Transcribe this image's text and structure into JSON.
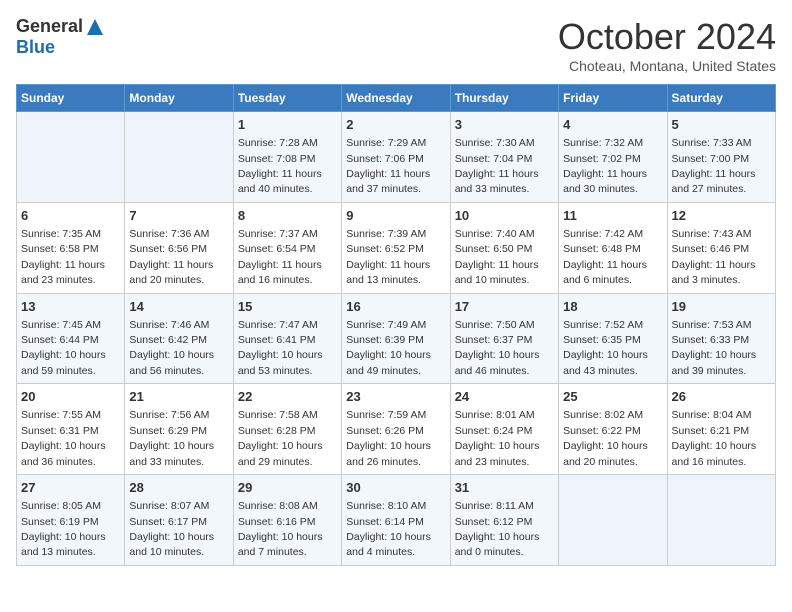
{
  "header": {
    "logo_general": "General",
    "logo_blue": "Blue",
    "title": "October 2024",
    "location": "Choteau, Montana, United States"
  },
  "days_of_week": [
    "Sunday",
    "Monday",
    "Tuesday",
    "Wednesday",
    "Thursday",
    "Friday",
    "Saturday"
  ],
  "weeks": [
    [
      {
        "day": "",
        "info": ""
      },
      {
        "day": "",
        "info": ""
      },
      {
        "day": "1",
        "info": "Sunrise: 7:28 AM\nSunset: 7:08 PM\nDaylight: 11 hours and 40 minutes."
      },
      {
        "day": "2",
        "info": "Sunrise: 7:29 AM\nSunset: 7:06 PM\nDaylight: 11 hours and 37 minutes."
      },
      {
        "day": "3",
        "info": "Sunrise: 7:30 AM\nSunset: 7:04 PM\nDaylight: 11 hours and 33 minutes."
      },
      {
        "day": "4",
        "info": "Sunrise: 7:32 AM\nSunset: 7:02 PM\nDaylight: 11 hours and 30 minutes."
      },
      {
        "day": "5",
        "info": "Sunrise: 7:33 AM\nSunset: 7:00 PM\nDaylight: 11 hours and 27 minutes."
      }
    ],
    [
      {
        "day": "6",
        "info": "Sunrise: 7:35 AM\nSunset: 6:58 PM\nDaylight: 11 hours and 23 minutes."
      },
      {
        "day": "7",
        "info": "Sunrise: 7:36 AM\nSunset: 6:56 PM\nDaylight: 11 hours and 20 minutes."
      },
      {
        "day": "8",
        "info": "Sunrise: 7:37 AM\nSunset: 6:54 PM\nDaylight: 11 hours and 16 minutes."
      },
      {
        "day": "9",
        "info": "Sunrise: 7:39 AM\nSunset: 6:52 PM\nDaylight: 11 hours and 13 minutes."
      },
      {
        "day": "10",
        "info": "Sunrise: 7:40 AM\nSunset: 6:50 PM\nDaylight: 11 hours and 10 minutes."
      },
      {
        "day": "11",
        "info": "Sunrise: 7:42 AM\nSunset: 6:48 PM\nDaylight: 11 hours and 6 minutes."
      },
      {
        "day": "12",
        "info": "Sunrise: 7:43 AM\nSunset: 6:46 PM\nDaylight: 11 hours and 3 minutes."
      }
    ],
    [
      {
        "day": "13",
        "info": "Sunrise: 7:45 AM\nSunset: 6:44 PM\nDaylight: 10 hours and 59 minutes."
      },
      {
        "day": "14",
        "info": "Sunrise: 7:46 AM\nSunset: 6:42 PM\nDaylight: 10 hours and 56 minutes."
      },
      {
        "day": "15",
        "info": "Sunrise: 7:47 AM\nSunset: 6:41 PM\nDaylight: 10 hours and 53 minutes."
      },
      {
        "day": "16",
        "info": "Sunrise: 7:49 AM\nSunset: 6:39 PM\nDaylight: 10 hours and 49 minutes."
      },
      {
        "day": "17",
        "info": "Sunrise: 7:50 AM\nSunset: 6:37 PM\nDaylight: 10 hours and 46 minutes."
      },
      {
        "day": "18",
        "info": "Sunrise: 7:52 AM\nSunset: 6:35 PM\nDaylight: 10 hours and 43 minutes."
      },
      {
        "day": "19",
        "info": "Sunrise: 7:53 AM\nSunset: 6:33 PM\nDaylight: 10 hours and 39 minutes."
      }
    ],
    [
      {
        "day": "20",
        "info": "Sunrise: 7:55 AM\nSunset: 6:31 PM\nDaylight: 10 hours and 36 minutes."
      },
      {
        "day": "21",
        "info": "Sunrise: 7:56 AM\nSunset: 6:29 PM\nDaylight: 10 hours and 33 minutes."
      },
      {
        "day": "22",
        "info": "Sunrise: 7:58 AM\nSunset: 6:28 PM\nDaylight: 10 hours and 29 minutes."
      },
      {
        "day": "23",
        "info": "Sunrise: 7:59 AM\nSunset: 6:26 PM\nDaylight: 10 hours and 26 minutes."
      },
      {
        "day": "24",
        "info": "Sunrise: 8:01 AM\nSunset: 6:24 PM\nDaylight: 10 hours and 23 minutes."
      },
      {
        "day": "25",
        "info": "Sunrise: 8:02 AM\nSunset: 6:22 PM\nDaylight: 10 hours and 20 minutes."
      },
      {
        "day": "26",
        "info": "Sunrise: 8:04 AM\nSunset: 6:21 PM\nDaylight: 10 hours and 16 minutes."
      }
    ],
    [
      {
        "day": "27",
        "info": "Sunrise: 8:05 AM\nSunset: 6:19 PM\nDaylight: 10 hours and 13 minutes."
      },
      {
        "day": "28",
        "info": "Sunrise: 8:07 AM\nSunset: 6:17 PM\nDaylight: 10 hours and 10 minutes."
      },
      {
        "day": "29",
        "info": "Sunrise: 8:08 AM\nSunset: 6:16 PM\nDaylight: 10 hours and 7 minutes."
      },
      {
        "day": "30",
        "info": "Sunrise: 8:10 AM\nSunset: 6:14 PM\nDaylight: 10 hours and 4 minutes."
      },
      {
        "day": "31",
        "info": "Sunrise: 8:11 AM\nSunset: 6:12 PM\nDaylight: 10 hours and 0 minutes."
      },
      {
        "day": "",
        "info": ""
      },
      {
        "day": "",
        "info": ""
      }
    ]
  ]
}
